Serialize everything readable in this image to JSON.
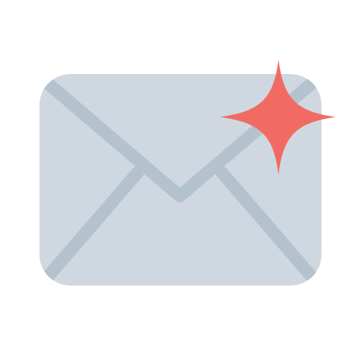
{
  "icon": {
    "name": "new-mail-icon",
    "parts": [
      "envelope-icon",
      "sparkle-icon"
    ]
  },
  "colors": {
    "background": "#ffffff",
    "envelope_body": "#cfd8e1",
    "envelope_lines": "#b4c2ce",
    "sparkle": "#f26b63"
  }
}
